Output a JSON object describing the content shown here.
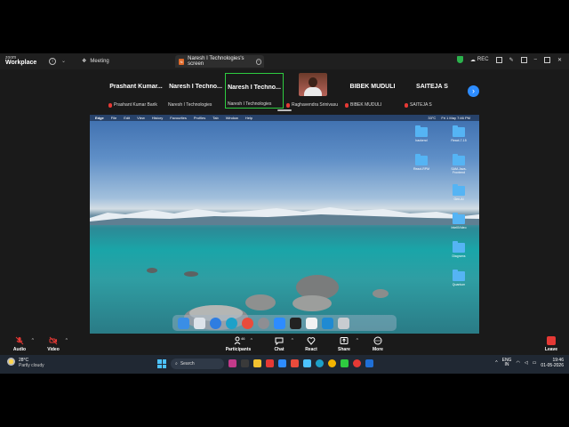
{
  "app": {
    "brand_top": "zoom",
    "brand_bottom": "Workplace"
  },
  "titlebar": {
    "meeting_label": "Meeting",
    "tab_label": "Naresh I Technologies's screen",
    "tab_favicon_text": "N",
    "rec_label": "REC"
  },
  "participants": [
    {
      "name": "Prashant Kumar...",
      "label": "Prashant Kumar Barik"
    },
    {
      "name": "Naresh I Techno...",
      "label": "Naresh I Technologies"
    },
    {
      "name": "Naresh I Techno...",
      "label": "Naresh I Technologies",
      "active": true
    },
    {
      "name": "",
      "label": "Raghavendra Srinivasu",
      "video": true
    },
    {
      "name": "BIBEK MUDULI",
      "label": "BIBEK MUDULI"
    },
    {
      "name": "SAITEJA S",
      "label": "SAITEJA S"
    }
  ],
  "shared_screen": {
    "menu_app": "Edge",
    "menu_items": [
      "File",
      "Edit",
      "View",
      "History",
      "Favourites",
      "Profiles",
      "Tab",
      "Window",
      "Help"
    ],
    "menu_temp": "33°C",
    "menu_datetime": "Fri 1 May  7:46 PM",
    "desktop_folders": [
      "backend",
      "React-7-15",
      "React-RPM",
      "SAM-Java-Frontend",
      "Gen-AI",
      "IntelliVideo",
      "Diagrams",
      "Quantum"
    ]
  },
  "toolbar": {
    "audio": "Audio",
    "video": "Video",
    "participants": "Participants",
    "participants_count": "46",
    "chat": "Chat",
    "react": "React",
    "share": "Share",
    "more": "More",
    "leave": "Leave"
  },
  "taskbar": {
    "temperature": "28°C",
    "weather": "Partly cloudy",
    "search_placeholder": "Search",
    "lang_top": "ENG",
    "lang_bottom": "IN",
    "time": "19:46",
    "date": "01-05-2026"
  },
  "colors": {
    "accent": "#2d8cff",
    "active_border": "#2ecc40",
    "leave": "#e53935"
  }
}
